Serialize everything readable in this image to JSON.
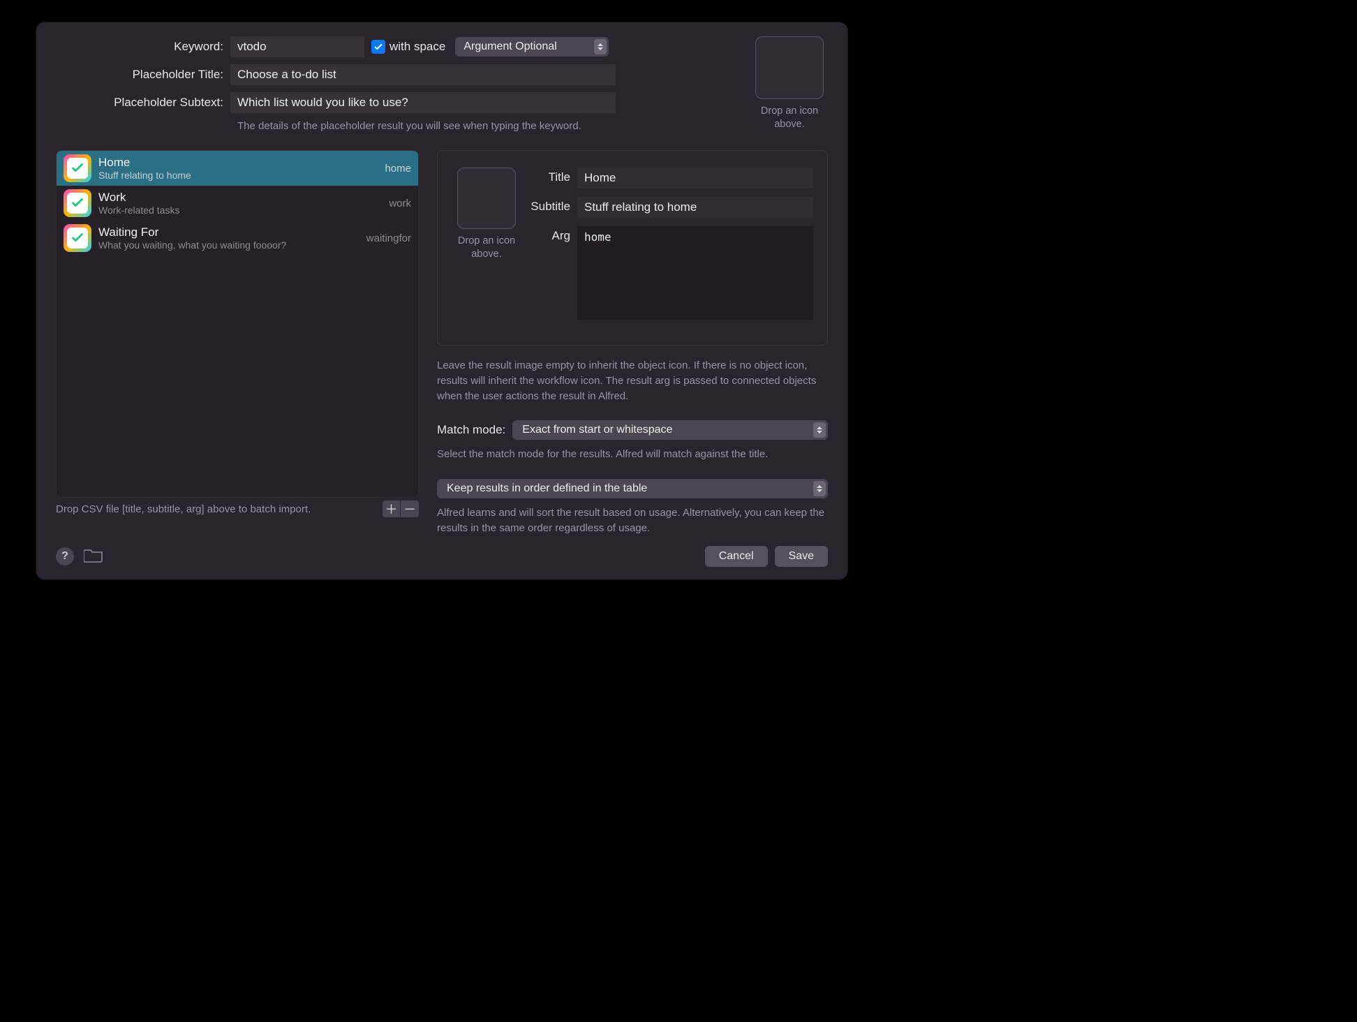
{
  "form": {
    "keyword_label": "Keyword:",
    "keyword_value": "vtodo",
    "with_space_checked": true,
    "with_space_label": "with space",
    "argument_mode": "Argument Optional",
    "placeholder_title_label": "Placeholder Title:",
    "placeholder_title_value": "Choose a to-do list",
    "placeholder_subtext_label": "Placeholder Subtext:",
    "placeholder_subtext_value": "Which list would you like to use?",
    "placeholder_help": "The details of the placeholder result you will see when typing the keyword.",
    "icon_drop_text": "Drop an icon above."
  },
  "items": [
    {
      "title": "Home",
      "subtitle": "Stuff relating to home",
      "arg": "home",
      "selected": true
    },
    {
      "title": "Work",
      "subtitle": "Work-related tasks",
      "arg": "work",
      "selected": false
    },
    {
      "title": "Waiting For",
      "subtitle": "What you waiting, what you waiting foooor?",
      "arg": "waitingfor",
      "selected": false
    }
  ],
  "csv_hint": "Drop CSV file [title, subtitle, arg] above to batch import.",
  "detail": {
    "icon_drop_text": "Drop an icon above.",
    "title_label": "Title",
    "title_value": "Home",
    "subtitle_label": "Subtitle",
    "subtitle_value": "Stuff relating to home",
    "arg_label": "Arg",
    "arg_value": "home"
  },
  "notes": {
    "result_image": "Leave the result image empty to inherit the object icon. If there is no object icon, results will inherit the workflow icon. The result arg is passed to connected objects when the user actions the result in Alfred.",
    "match_mode_label": "Match mode:",
    "match_mode_value": "Exact from start or whitespace",
    "match_mode_help": "Select the match mode for the results. Alfred will match against the title.",
    "order_value": "Keep results in order defined in the table",
    "order_help": "Alfred learns and will sort the result based on usage. Alternatively, you can keep the results in the same order regardless of usage."
  },
  "buttons": {
    "cancel": "Cancel",
    "save": "Save"
  }
}
